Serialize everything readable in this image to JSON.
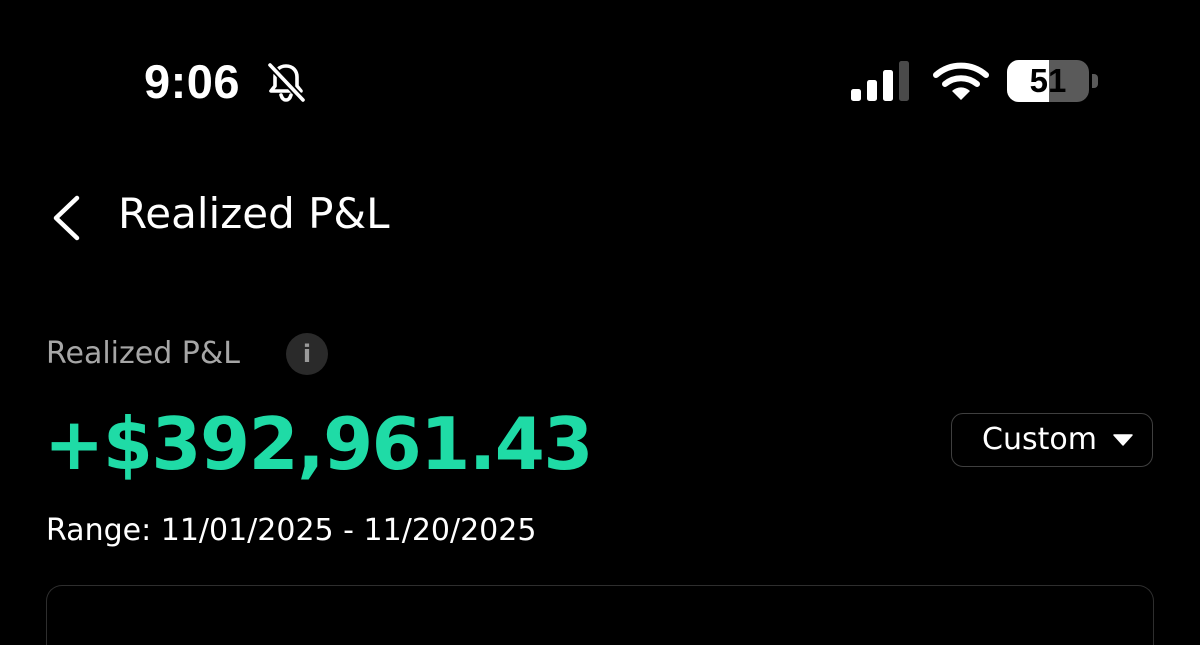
{
  "status_bar": {
    "time": "9:06",
    "mute_icon": "bell-slash-icon",
    "signal_icon": "cellular-signal-icon",
    "wifi_icon": "wifi-icon",
    "battery_icon": "battery-icon",
    "battery_level": "51",
    "battery_fraction": 0.51
  },
  "header": {
    "back_icon": "chevron-left-icon",
    "title": "Realized P&L"
  },
  "summary": {
    "label": "Realized P&L",
    "info_icon": "info-icon",
    "info_glyph": "i",
    "value": "+$392,961.43",
    "range_select": {
      "selected": "Custom",
      "caret_icon": "caret-down-icon"
    },
    "range_text": "Range: 11/01/2025 - 11/20/2025"
  },
  "colors": {
    "background": "#000000",
    "positive": "#1fdba6",
    "secondary_text": "#a6a6a6",
    "border": "#3f3f3f"
  }
}
